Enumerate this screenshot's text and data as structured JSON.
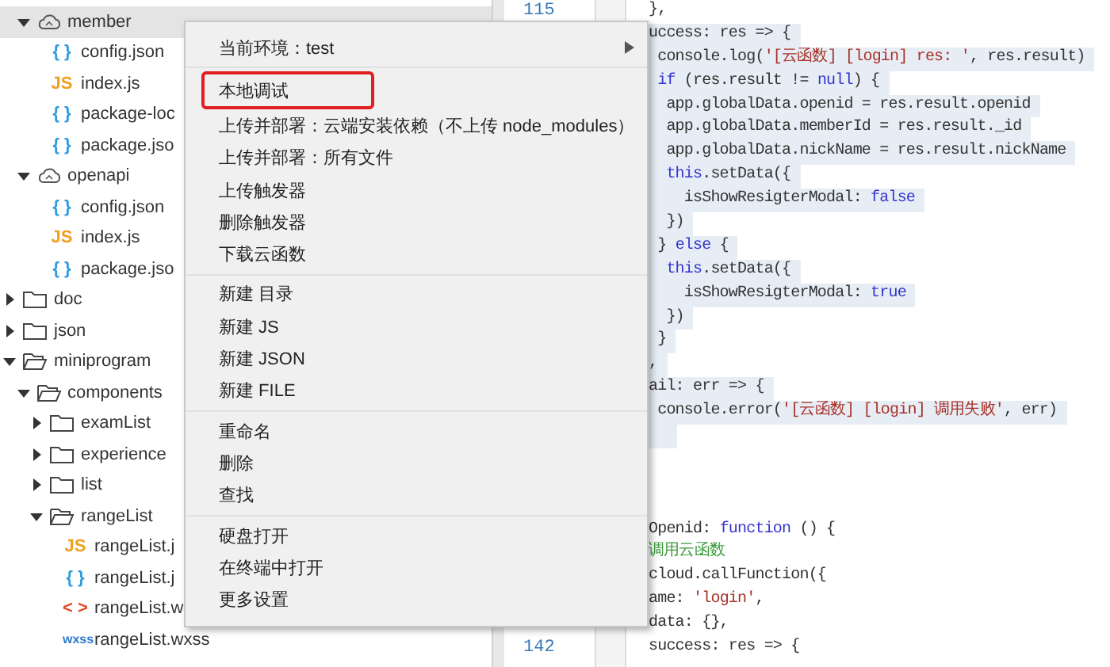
{
  "tree": {
    "partial_children": [
      {
        "label": "member",
        "kind": "cloud",
        "expanded": true,
        "selected": true,
        "children": [
          {
            "label": "config.json",
            "kind": "json",
            "icon_text": "{ }",
            "selected": false
          },
          {
            "label": "index.js",
            "kind": "js",
            "icon_text": "JS",
            "selected": false
          },
          {
            "label": "package-loc",
            "kind": "json",
            "icon_text": "{ }",
            "selected": false
          },
          {
            "label": "package.jso",
            "kind": "json",
            "icon_text": "{ }",
            "selected": false
          }
        ]
      },
      {
        "label": "openapi",
        "kind": "cloud",
        "expanded": true,
        "selected": false,
        "children": [
          {
            "label": "config.json",
            "kind": "json",
            "icon_text": "{ }",
            "selected": false
          },
          {
            "label": "index.js",
            "kind": "js",
            "icon_text": "JS",
            "selected": false
          },
          {
            "label": "package.jso",
            "kind": "json",
            "icon_text": "{ }",
            "selected": false
          }
        ]
      }
    ],
    "items": [
      {
        "label": "doc",
        "kind": "folder",
        "expanded": false,
        "selected": false
      },
      {
        "label": "json",
        "kind": "folder",
        "expanded": false,
        "selected": false
      },
      {
        "label": "miniprogram",
        "kind": "folder",
        "expanded": true,
        "selected": false,
        "children": [
          {
            "label": "components",
            "kind": "folder",
            "expanded": true,
            "selected": false,
            "children": [
              {
                "label": "examList",
                "kind": "folder",
                "expanded": false,
                "selected": false
              },
              {
                "label": "experience",
                "kind": "folder",
                "expanded": false,
                "selected": false
              },
              {
                "label": "list",
                "kind": "folder",
                "expanded": false,
                "selected": false
              },
              {
                "label": "rangeList",
                "kind": "folder",
                "expanded": true,
                "selected": false,
                "children": [
                  {
                    "label": "rangeList.j",
                    "kind": "js",
                    "icon_text": "JS",
                    "selected": false
                  },
                  {
                    "label": "rangeList.j",
                    "kind": "json",
                    "icon_text": "{ }",
                    "selected": false
                  },
                  {
                    "label": "rangeList.w",
                    "kind": "wxml",
                    "icon_text": "< >",
                    "selected": false
                  },
                  {
                    "label": "rangeList.wxss",
                    "kind": "wxss",
                    "icon_text": "wxss",
                    "selected": false
                  }
                ]
              }
            ]
          }
        ]
      }
    ]
  },
  "context_menu": {
    "groups": [
      [
        {
          "label": "当前环境：test",
          "kind": "submenu",
          "highlighted": false
        }
      ],
      [
        {
          "label": "本地调试",
          "kind": "action",
          "highlighted": true
        },
        {
          "label": "上传并部署：云端安装依赖（不上传 node_modules）",
          "kind": "action",
          "highlighted": false
        },
        {
          "label": "上传并部署：所有文件",
          "kind": "action",
          "highlighted": false
        },
        {
          "label": "上传触发器",
          "kind": "action",
          "highlighted": false
        },
        {
          "label": "删除触发器",
          "kind": "action",
          "highlighted": false
        },
        {
          "label": "下载云函数",
          "kind": "action",
          "highlighted": false
        }
      ],
      [
        {
          "label": "新建 目录",
          "kind": "action",
          "highlighted": false
        },
        {
          "label": "新建 JS",
          "kind": "action",
          "highlighted": false
        },
        {
          "label": "新建 JSON",
          "kind": "action",
          "highlighted": false
        },
        {
          "label": "新建 FILE",
          "kind": "action",
          "highlighted": false
        }
      ],
      [
        {
          "label": "重命名",
          "kind": "action",
          "highlighted": false
        },
        {
          "label": "删除",
          "kind": "action",
          "highlighted": false
        },
        {
          "label": "查找",
          "kind": "action",
          "highlighted": false
        }
      ],
      [
        {
          "label": "硬盘打开",
          "kind": "action",
          "highlighted": false
        },
        {
          "label": "在终端中打开",
          "kind": "action",
          "highlighted": false
        },
        {
          "label": "更多设置",
          "kind": "action",
          "highlighted": false
        }
      ]
    ]
  },
  "code": {
    "lines": [
      {
        "line_number": "115",
        "highlighted": false,
        "tokens": [
          {
            "text": "},",
            "kind": "plain"
          }
        ]
      },
      {
        "highlighted": true,
        "tokens": [
          {
            "text": "uccess: res => {",
            "kind": "plain"
          }
        ]
      },
      {
        "highlighted": true,
        "tokens": [
          {
            "text": " console.log(",
            "kind": "plain"
          },
          {
            "text": "'[云函数] [login] res: '",
            "kind": "string"
          },
          {
            "text": ", res.result)",
            "kind": "plain"
          }
        ]
      },
      {
        "highlighted": true,
        "tokens": [
          {
            "text": " if",
            "kind": "keyword"
          },
          {
            "text": " (res.result != ",
            "kind": "plain"
          },
          {
            "text": "null",
            "kind": "keyword"
          },
          {
            "text": ") {",
            "kind": "plain"
          }
        ]
      },
      {
        "highlighted": true,
        "tokens": [
          {
            "text": "  app.globalData.openid = res.result.openid",
            "kind": "plain"
          }
        ]
      },
      {
        "highlighted": true,
        "tokens": [
          {
            "text": "  app.globalData.memberId = res.result._id",
            "kind": "plain"
          }
        ]
      },
      {
        "highlighted": true,
        "tokens": [
          {
            "text": "  app.globalData.nickName = res.result.nickName",
            "kind": "plain"
          }
        ]
      },
      {
        "highlighted": true,
        "tokens": [
          {
            "text": "  this",
            "kind": "keyword"
          },
          {
            "text": ".setData({",
            "kind": "plain"
          }
        ]
      },
      {
        "highlighted": true,
        "tokens": [
          {
            "text": "    isShowResigterModal: ",
            "kind": "plain"
          },
          {
            "text": "false",
            "kind": "keyword"
          }
        ]
      },
      {
        "highlighted": true,
        "tokens": [
          {
            "text": "  })",
            "kind": "plain"
          }
        ]
      },
      {
        "highlighted": true,
        "tokens": [
          {
            "text": " } ",
            "kind": "plain"
          },
          {
            "text": "else",
            "kind": "keyword"
          },
          {
            "text": " {",
            "kind": "plain"
          }
        ]
      },
      {
        "highlighted": true,
        "tokens": [
          {
            "text": "  this",
            "kind": "keyword"
          },
          {
            "text": ".setData({",
            "kind": "plain"
          }
        ]
      },
      {
        "highlighted": true,
        "tokens": [
          {
            "text": "    isShowResigterModal: ",
            "kind": "plain"
          },
          {
            "text": "true",
            "kind": "keyword"
          }
        ]
      },
      {
        "highlighted": true,
        "tokens": [
          {
            "text": "  })",
            "kind": "plain"
          }
        ]
      },
      {
        "highlighted": true,
        "tokens": [
          {
            "text": " }",
            "kind": "plain"
          }
        ]
      },
      {
        "highlighted": true,
        "tokens": [
          {
            "text": ",",
            "kind": "plain"
          }
        ]
      },
      {
        "highlighted": true,
        "tokens": [
          {
            "text": "ail: err => {",
            "kind": "plain"
          }
        ]
      },
      {
        "highlighted": true,
        "tokens": [
          {
            "text": " console.error(",
            "kind": "plain"
          },
          {
            "text": "'[云函数] [login] 调用失败'",
            "kind": "string"
          },
          {
            "text": ", err)",
            "kind": "plain"
          }
        ]
      },
      {
        "highlighted": true
      },
      {
        "highlighted": false
      },
      {
        "highlighted": false
      },
      {
        "highlighted": false
      },
      {
        "highlighted": false,
        "tokens": [
          {
            "text": "Openid: ",
            "kind": "plain"
          },
          {
            "text": "function",
            "kind": "keyword"
          },
          {
            "text": " () {",
            "kind": "plain"
          }
        ]
      },
      {
        "highlighted": false,
        "tokens": [
          {
            "text": "调用云函数",
            "kind": "comment"
          }
        ]
      },
      {
        "highlighted": false,
        "tokens": [
          {
            "text": "cloud.callFunction({",
            "kind": "plain"
          }
        ]
      },
      {
        "highlighted": false,
        "tokens": [
          {
            "text": "ame: ",
            "kind": "plain"
          },
          {
            "text": "'login'",
            "kind": "string"
          },
          {
            "text": ",",
            "kind": "plain"
          }
        ]
      },
      {
        "highlighted": false,
        "tokens": [
          {
            "text": "data: {},",
            "kind": "plain"
          }
        ]
      },
      {
        "line_number": "142",
        "highlighted": false,
        "tokens": [
          {
            "text": "success: res => {",
            "kind": "plain"
          }
        ]
      }
    ]
  }
}
